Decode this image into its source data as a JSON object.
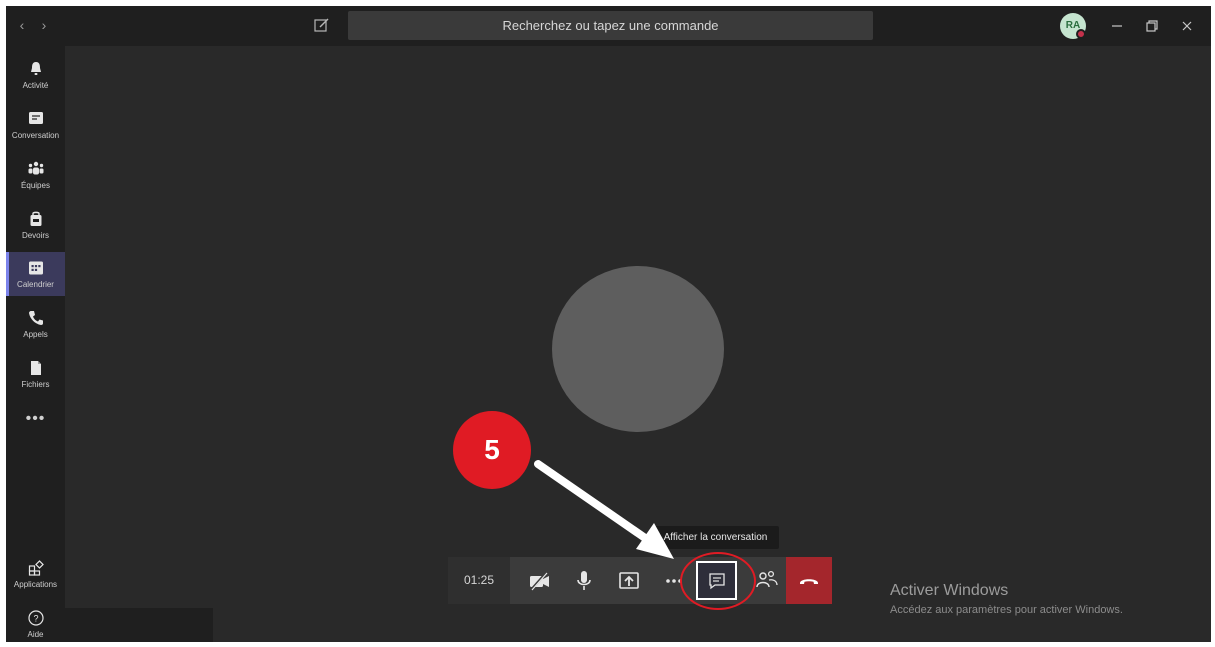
{
  "header": {
    "search_placeholder": "Recherchez ou tapez une commande",
    "avatar_initials": "RA",
    "nav_back": "‹",
    "nav_forward": "›"
  },
  "rail": {
    "items": [
      {
        "label": "Activité",
        "icon": "bell-icon"
      },
      {
        "label": "Conversation",
        "icon": "chat-icon"
      },
      {
        "label": "Équipes",
        "icon": "teams-icon"
      },
      {
        "label": "Devoirs",
        "icon": "assignments-icon"
      },
      {
        "label": "Calendrier",
        "icon": "calendar-icon",
        "active": true
      },
      {
        "label": "Appels",
        "icon": "phone-icon"
      },
      {
        "label": "Fichiers",
        "icon": "file-icon"
      }
    ],
    "more": "•••",
    "apps_label": "Applications",
    "help_label": "Aide"
  },
  "call": {
    "timer": "01:25",
    "tooltip": "Afficher la conversation"
  },
  "annotation": {
    "step_number": "5",
    "color": "#e01b24"
  },
  "watermark": {
    "title": "Activer Windows",
    "subtitle": "Accédez aux paramètres pour activer Windows."
  },
  "colors": {
    "hangup": "#a4262c",
    "active_rail": "#3b3a5c",
    "accent": "#7b83eb"
  }
}
